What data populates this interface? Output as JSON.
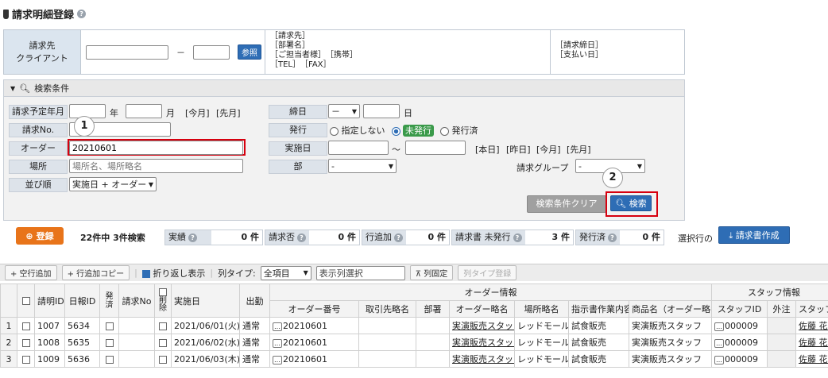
{
  "page": {
    "title": "請求明細登録"
  },
  "client": {
    "label_line1": "請求先",
    "label_line2": "クライアント",
    "dash": "－",
    "ref_button": "参照",
    "info_lines": [
      "［請求先］",
      "［部署名］",
      "［ご担当者様］",
      "［TEL］",
      "［FAX］"
    ],
    "info_mobile": "［携帯］",
    "info2_lines": [
      "［請求締日］",
      "［支払い日］"
    ]
  },
  "search": {
    "header": "検索条件",
    "billing_month_label": "請求予定年月",
    "year_unit": "年",
    "month_unit": "月",
    "this_month": "[今月]",
    "last_month": "[先月]",
    "closing_label": "締日",
    "closing_value": "－",
    "day_unit": "日",
    "invoice_no_label": "請求No.",
    "issue_label": "発行",
    "issue_options": [
      "指定しない",
      "未発行",
      "発行済"
    ],
    "order_label": "オーダー",
    "order_value": "20210601",
    "impl_date_label": "実施日",
    "tilde": "～",
    "date_links": [
      "[本日]",
      "[昨日]",
      "[今月]",
      "[先月]"
    ],
    "place_label": "場所",
    "place_placeholder": "場所名、場所略名",
    "dept_label": "部",
    "dept_value": "-",
    "billing_group_label": "請求グループ",
    "billing_group_value": "-",
    "sort_label": "並び順",
    "sort_value": "実施日 + オーダー",
    "clear_button": "検索条件クリア",
    "search_button": "検索",
    "marker1": "1",
    "marker2": "2"
  },
  "summary": {
    "register_button": "登録",
    "count_text": "22件中 3件検索",
    "stats": [
      {
        "label": "実績",
        "value": "0 件"
      },
      {
        "label": "請求否",
        "value": "0 件"
      },
      {
        "label": "行追加",
        "value": "0 件"
      },
      {
        "label": "請求書 未発行",
        "value": "3 件"
      },
      {
        "label": "発行済",
        "value": "0 件"
      }
    ],
    "selected_rows": "選択行の",
    "create_invoice_button": "請求書作成"
  },
  "toolbar": {
    "add_empty_row": "+ 空行追加",
    "copy_row": "+ 行追加コピー",
    "wrap_label": "折り返し表示",
    "column_type_label": "列タイプ:",
    "column_type_value": "全項目",
    "display_column_select": "表示列選択",
    "fix_column": "列固定",
    "register_column_type": "列タイプ登録"
  },
  "table": {
    "group_headers": {
      "order": "オーダー情報",
      "staff": "スタッフ情報"
    },
    "headers": {
      "invoice_id": "請明ID",
      "daily_id": "日報ID",
      "issued": "発済",
      "invoice_no": "請求No",
      "delete": "削除",
      "impl_date": "実施日",
      "attendance": "出勤",
      "order_no": "オーダー番号",
      "client_short": "取引先略名",
      "dept": "部署",
      "order_short": "オーダー略名",
      "place_short": "場所略名",
      "instruction": "指示書作業内容",
      "product": "商品名（オーダー略名）",
      "staff_id": "スタッフID",
      "outsourced": "外注",
      "staff_name": "スタッフ名"
    },
    "rows": [
      {
        "no": "1",
        "invoice_id": "1007",
        "daily_id": "5634",
        "date": "2021/06/01(火)",
        "attendance": "通常",
        "order_no": "20210601",
        "order_short": "実演販売スタッフ",
        "place_short": "レッドモール",
        "instruction": "試食販売",
        "product": "実演販売スタッフ",
        "staff_id": "000009",
        "staff_name": "佐藤 花子"
      },
      {
        "no": "2",
        "invoice_id": "1008",
        "daily_id": "5635",
        "date": "2021/06/02(水)",
        "attendance": "通常",
        "order_no": "20210601",
        "order_short": "実演販売スタッフ",
        "place_short": "レッドモール",
        "instruction": "試食販売",
        "product": "実演販売スタッフ",
        "staff_id": "000009",
        "staff_name": "佐藤 花子"
      },
      {
        "no": "3",
        "invoice_id": "1009",
        "daily_id": "5636",
        "date": "2021/06/03(木)",
        "attendance": "通常",
        "order_no": "20210601",
        "order_short": "実演販売スタッフ",
        "place_short": "レッドモール",
        "instruction": "試食販売",
        "product": "実演販売スタッフ",
        "staff_id": "000009",
        "staff_name": "佐藤 花子"
      }
    ]
  }
}
